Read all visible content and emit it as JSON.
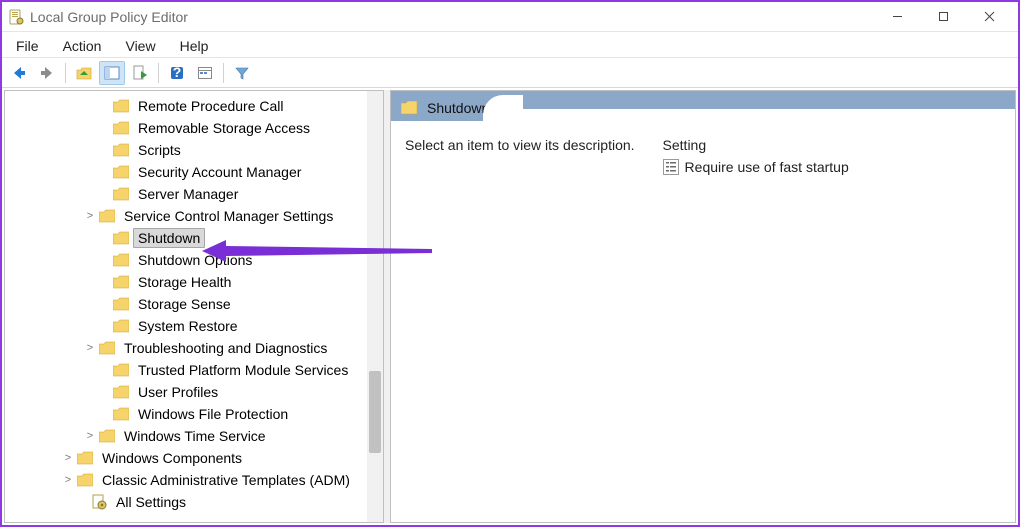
{
  "title": "Local Group Policy Editor",
  "menu": [
    "File",
    "Action",
    "View",
    "Help"
  ],
  "tree": [
    {
      "ind": 92,
      "exp": "",
      "label": "Remote Procedure Call"
    },
    {
      "ind": 92,
      "exp": "",
      "label": "Removable Storage Access"
    },
    {
      "ind": 92,
      "exp": "",
      "label": "Scripts"
    },
    {
      "ind": 92,
      "exp": "",
      "label": "Security Account Manager"
    },
    {
      "ind": 92,
      "exp": "",
      "label": "Server Manager"
    },
    {
      "ind": 78,
      "exp": ">",
      "label": "Service Control Manager Settings"
    },
    {
      "ind": 92,
      "exp": "",
      "label": "Shutdown",
      "selected": true
    },
    {
      "ind": 92,
      "exp": "",
      "label": "Shutdown Options"
    },
    {
      "ind": 92,
      "exp": "",
      "label": "Storage Health"
    },
    {
      "ind": 92,
      "exp": "",
      "label": "Storage Sense"
    },
    {
      "ind": 92,
      "exp": "",
      "label": "System Restore"
    },
    {
      "ind": 78,
      "exp": ">",
      "label": "Troubleshooting and Diagnostics"
    },
    {
      "ind": 92,
      "exp": "",
      "label": "Trusted Platform Module Services"
    },
    {
      "ind": 92,
      "exp": "",
      "label": "User Profiles"
    },
    {
      "ind": 92,
      "exp": "",
      "label": "Windows File Protection"
    },
    {
      "ind": 78,
      "exp": ">",
      "label": "Windows Time Service"
    },
    {
      "ind": 56,
      "exp": ">",
      "label": "Windows Components"
    },
    {
      "ind": 56,
      "exp": ">",
      "label": "Classic Administrative Templates (ADM)"
    },
    {
      "ind": 70,
      "exp": "",
      "label": "All Settings",
      "icon": "cog"
    }
  ],
  "right": {
    "header": "Shutdown",
    "hint": "Select an item to view its description.",
    "col": "Setting",
    "items": [
      "Require use of fast startup"
    ]
  }
}
